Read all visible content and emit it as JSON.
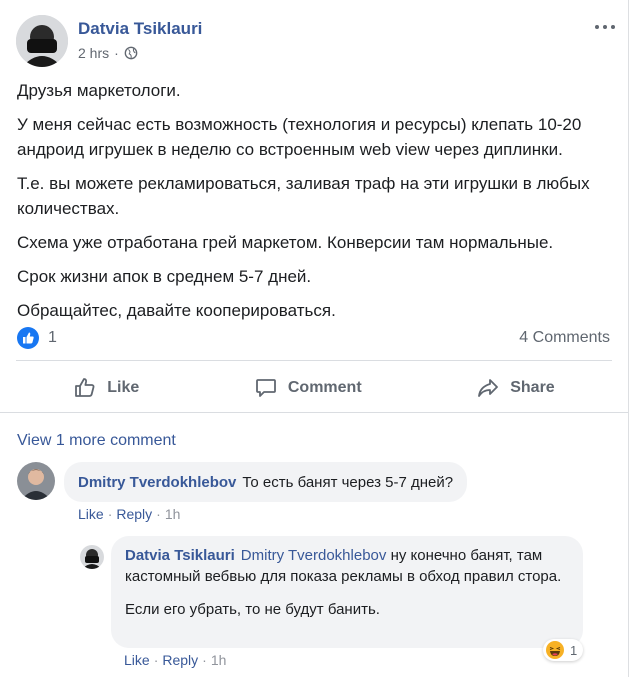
{
  "post": {
    "author": "Datvia Tsiklauri",
    "time": "2 hrs",
    "separator": "·",
    "paragraphs": [
      "Друзья маркетологи.",
      "У меня сейчас есть возможность (технология и ресурсы) клепать 10-20 андроид игрушек в неделю со встроенным web view через диплинки.",
      "Т.е. вы можете рекламироваться, заливая траф на эти игрушки в любых количествах.",
      "Схема уже отработана грей маркетом. Конверсии там нормальные.",
      "Срок жизни апок в среднем 5-7 дней.",
      "Обращайтес, давайте кооперироваться."
    ],
    "reaction_count": "1",
    "comments_count": "4 Comments"
  },
  "actions": {
    "like": "Like",
    "comment": "Comment",
    "share": "Share"
  },
  "comments": {
    "view_more": "View 1 more comment",
    "first": {
      "author": "Dmitry Tverdokhlebov",
      "text": "То есть банят через 5-7 дней?",
      "like": "Like",
      "reply": "Reply",
      "time": "1h",
      "sep": "·"
    },
    "reply": {
      "author": "Datvia Tsiklauri",
      "mention": "Dmitry Tverdokhlebov",
      "text1": "ну конечно банят, там кастомный вебвью для показа рекламы в обход правил стора.",
      "text2": "Если его убрать, то не будут банить.",
      "reaction_count": "1",
      "like": "Like",
      "reply": "Reply",
      "time": "1h",
      "sep": "·"
    }
  },
  "colors": {
    "link": "#385898",
    "like_blue": "#1877f2",
    "muted": "#606770",
    "bubble": "#f2f3f5"
  },
  "icons": {
    "more": "more-horizontal-icon",
    "privacy": "globe-icon",
    "like_badge": "thumbs-up-badge-icon",
    "like": "thumbs-up-outline-icon",
    "comment": "speech-bubble-icon",
    "share": "share-arrow-icon",
    "haha": "haha-emoji-icon"
  }
}
